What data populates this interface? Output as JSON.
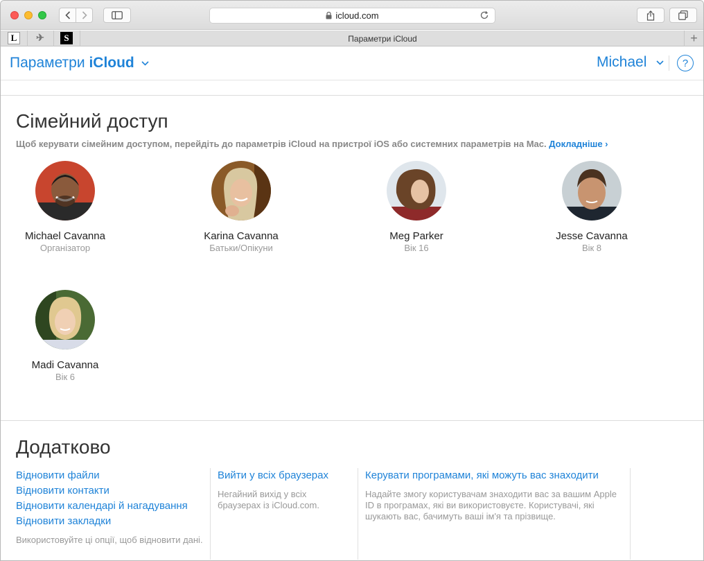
{
  "browser": {
    "address": "icloud.com",
    "tab_title": "Параметри iCloud",
    "favorites": [
      "L",
      "S"
    ],
    "new_tab": "+"
  },
  "header": {
    "title_prefix": "Параметри",
    "title_brand": "iCloud",
    "user": "Michael",
    "help": "?",
    "accent_color": "#1f83d8"
  },
  "family": {
    "title": "Сімейний доступ",
    "description": "Щоб керувати сімейним доступом, перейдіть до параметрів iCloud на пристрої iOS або системних параметрів на Mac.",
    "learn_more": "Докладніше ›",
    "members": [
      {
        "name": "Michael Cavanna",
        "role": "Організатор",
        "avatar": "avatar-photo"
      },
      {
        "name": "Karina Cavanna",
        "role": "Батьки/Опікуни",
        "avatar": "avatar-photo"
      },
      {
        "name": "Meg Parker",
        "role": "Вік 16",
        "avatar": "avatar-photo"
      },
      {
        "name": "Jesse Cavanna",
        "role": "Вік 8",
        "avatar": "avatar-photo"
      },
      {
        "name": "Madi Cavanna",
        "role": "Вік 6",
        "avatar": "avatar-photo"
      }
    ]
  },
  "advanced": {
    "title": "Додатково",
    "restore_links": [
      "Відновити файли",
      "Відновити контакти",
      "Відновити календарі й нагадування",
      "Відновити закладки"
    ],
    "restore_note": "Використовуйте ці опції, щоб відновити дані.",
    "signout_link": "Вийти у всіх браузерах",
    "signout_note": "Негайний вихід у всіх браузерах із iCloud.com.",
    "manage_link": "Керувати програмами, які можуть вас знаходити",
    "manage_note": "Надайте змогу користувачам знаходити вас за вашим Apple ID в програмах, які ви використовуєте. Користувачі, які шукають вас, бачимуть ваші ім'я та прізвище."
  }
}
